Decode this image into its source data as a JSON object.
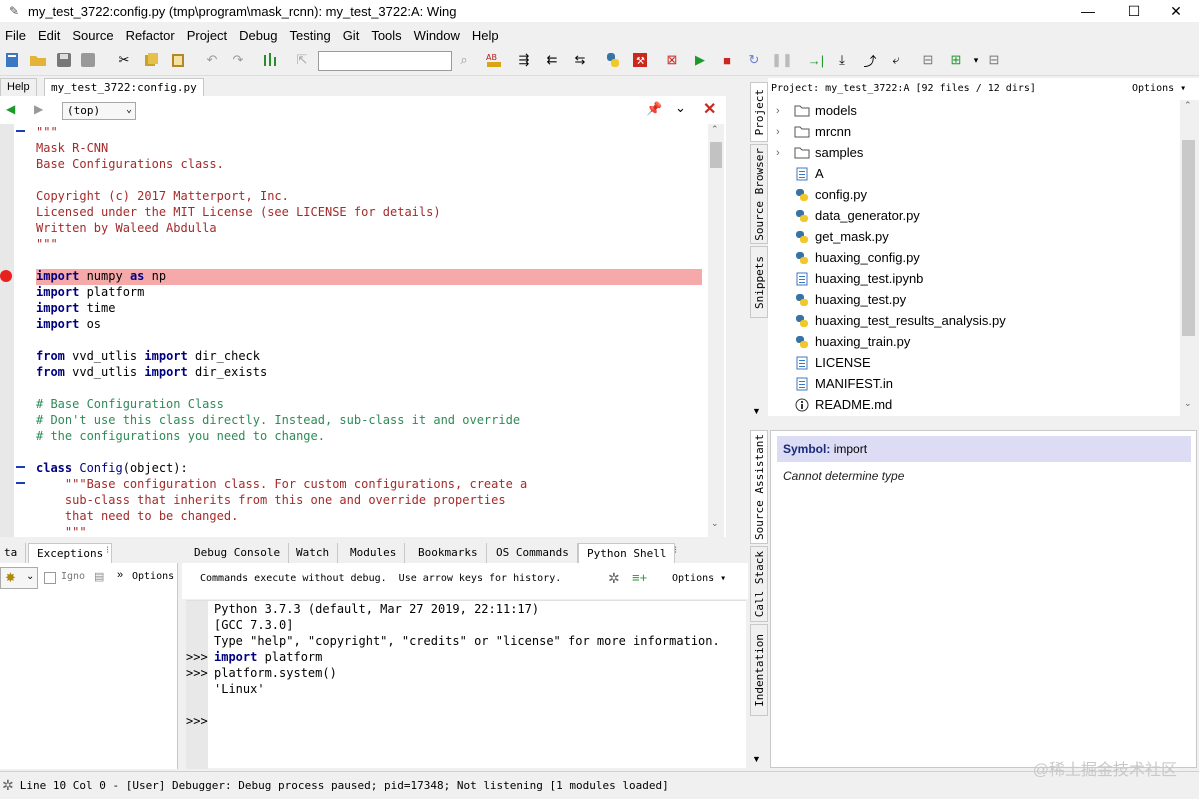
{
  "window": {
    "title": "my_test_3722:config.py (tmp\\program\\mask_rcnn): my_test_3722:A: Wing",
    "minimize": "—",
    "maximize": "☐",
    "close": "✕"
  },
  "menu": [
    "File",
    "Edit",
    "Source",
    "Refactor",
    "Project",
    "Debug",
    "Testing",
    "Git",
    "Tools",
    "Window",
    "Help"
  ],
  "toolbar": {
    "search_value": ""
  },
  "editor": {
    "tabs": [
      {
        "label": "Help",
        "active": false
      },
      {
        "label": "my_test_3722:config.py",
        "active": true
      }
    ],
    "scope": "(top)",
    "code_lines": [
      "\"\"\"",
      "Mask R-CNN",
      "Base Configurations class.",
      "",
      "Copyright (c) 2017 Matterport, Inc.",
      "Licensed under the MIT License (see LICENSE for details)",
      "Written by Waleed Abdulla",
      "\"\"\"",
      "",
      "import numpy as np",
      "import platform",
      "import time",
      "import os",
      "",
      "from vvd_utlis import dir_check",
      "from vvd_utlis import dir_exists",
      "",
      "# Base Configuration Class",
      "# Don't use this class directly. Instead, sub-class it and override",
      "# the configurations you need to change.",
      "",
      "class Config(object):",
      "    \"\"\"Base configuration class. For custom configurations, create a",
      "    sub-class that inherits from this one and override properties",
      "    that need to be changed.",
      "    \"\"\""
    ]
  },
  "bottom_left": {
    "tabs": [
      "ta",
      "Exceptions"
    ],
    "ignore_label": "Igno",
    "options_label": "Options"
  },
  "shell": {
    "tabs": [
      "Debug Console",
      "Watch",
      "Modules",
      "Bookmarks",
      "OS Commands",
      "Python Shell"
    ],
    "hint": "Commands execute without debug.  Use arrow keys for history.",
    "options_label": "Options",
    "lines": [
      {
        "prompt": "",
        "text": "Python 3.7.3 (default, Mar 27 2019, 22:11:17)"
      },
      {
        "prompt": "",
        "text": "[GCC 7.3.0]"
      },
      {
        "prompt": "",
        "text": "Type \"help\", \"copyright\", \"credits\" or \"license\" for more information."
      },
      {
        "prompt": ">>>",
        "text": "import platform"
      },
      {
        "prompt": ">>>",
        "text": "platform.system()"
      },
      {
        "prompt": "",
        "text": "'Linux'"
      },
      {
        "prompt": "",
        "text": ""
      },
      {
        "prompt": ">>>",
        "text": ""
      }
    ]
  },
  "project": {
    "header": "Project: my_test_3722:A [92 files / 12 dirs]",
    "options_label": "Options",
    "items": [
      {
        "label": "models",
        "type": "folder"
      },
      {
        "label": "mrcnn",
        "type": "folder"
      },
      {
        "label": "samples",
        "type": "folder"
      },
      {
        "label": "A",
        "type": "file"
      },
      {
        "label": "config.py",
        "type": "python"
      },
      {
        "label": "data_generator.py",
        "type": "python"
      },
      {
        "label": "get_mask.py",
        "type": "python"
      },
      {
        "label": "huaxing_config.py",
        "type": "python"
      },
      {
        "label": "huaxing_test.ipynb",
        "type": "file"
      },
      {
        "label": "huaxing_test.py",
        "type": "python"
      },
      {
        "label": "huaxing_test_results_analysis.py",
        "type": "python"
      },
      {
        "label": "huaxing_train.py",
        "type": "python"
      },
      {
        "label": "LICENSE",
        "type": "file"
      },
      {
        "label": "MANIFEST.in",
        "type": "file"
      },
      {
        "label": "README.md",
        "type": "info"
      }
    ]
  },
  "right_tabs_top": [
    "Project",
    "Source Browser",
    "Snippets"
  ],
  "right_tabs_bottom": [
    "Source Assistant",
    "Call Stack",
    "Indentation"
  ],
  "source_assistant": {
    "symbol_label": "Symbol:",
    "symbol_value": "import",
    "description": "Cannot determine type"
  },
  "status": {
    "text": "Line 10 Col 0 - [User] Debugger: Debug process paused; pid=17348; Not listening [1 modules loaded]"
  },
  "watermark": "@稀土掘金技术社区",
  "colors": {
    "breakpoint_line": "#f6a9a9",
    "breakpoint_dot": "#e8201e",
    "keyword": "#000080",
    "string": "#a52a2a",
    "comment": "#2e8b57",
    "symbol_bg": "#dcdcf5"
  }
}
